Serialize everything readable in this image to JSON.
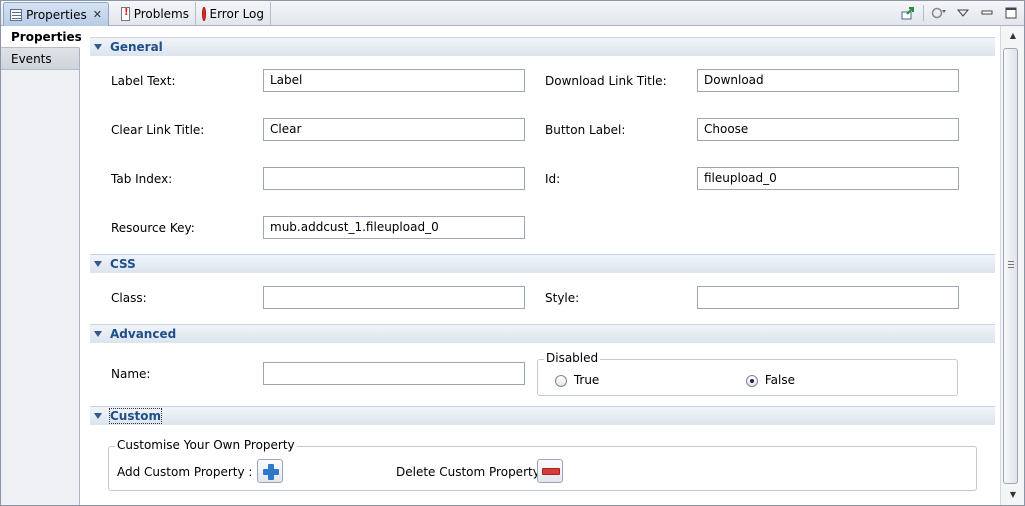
{
  "tabs": [
    {
      "label": "Properties",
      "icon": "properties-icon",
      "active": true,
      "close": "✕"
    },
    {
      "label": "Problems",
      "icon": "problems-icon"
    },
    {
      "label": "Error Log",
      "icon": "error-log-icon"
    }
  ],
  "section_tabs": [
    "Properties",
    "Events"
  ],
  "sections": {
    "general": "General",
    "css": "CSS",
    "advanced": "Advanced",
    "custom": "Custom"
  },
  "general": {
    "label_text": {
      "label": "Label Text:",
      "value": "Label"
    },
    "download_link_title": {
      "label": "Download Link Title:",
      "value": "Download"
    },
    "clear_link_title": {
      "label": "Clear Link Title:",
      "value": "Clear"
    },
    "button_label": {
      "label": "Button Label:",
      "value": "Choose"
    },
    "tab_index": {
      "label": "Tab Index:",
      "value": ""
    },
    "id": {
      "label": "Id:",
      "value": "fileupload_0"
    },
    "resource_key": {
      "label": "Resource Key:",
      "value": "mub.addcust_1.fileupload_0"
    }
  },
  "css": {
    "class": {
      "label": "Class:",
      "value": ""
    },
    "style": {
      "label": "Style:",
      "value": ""
    }
  },
  "advanced": {
    "name": {
      "label": "Name:",
      "value": ""
    },
    "disabled": {
      "title": "Disabled",
      "options": [
        "True",
        "False"
      ],
      "selected": "False"
    }
  },
  "custom": {
    "group_title": "Customise Your Own Property",
    "add_label": "Add Custom Property :",
    "delete_label": "Delete Custom Property :"
  },
  "colors": {
    "section_title": "#1f4f8a",
    "add_icon": "#2e78c8",
    "delete_icon": "#d63a3a"
  }
}
